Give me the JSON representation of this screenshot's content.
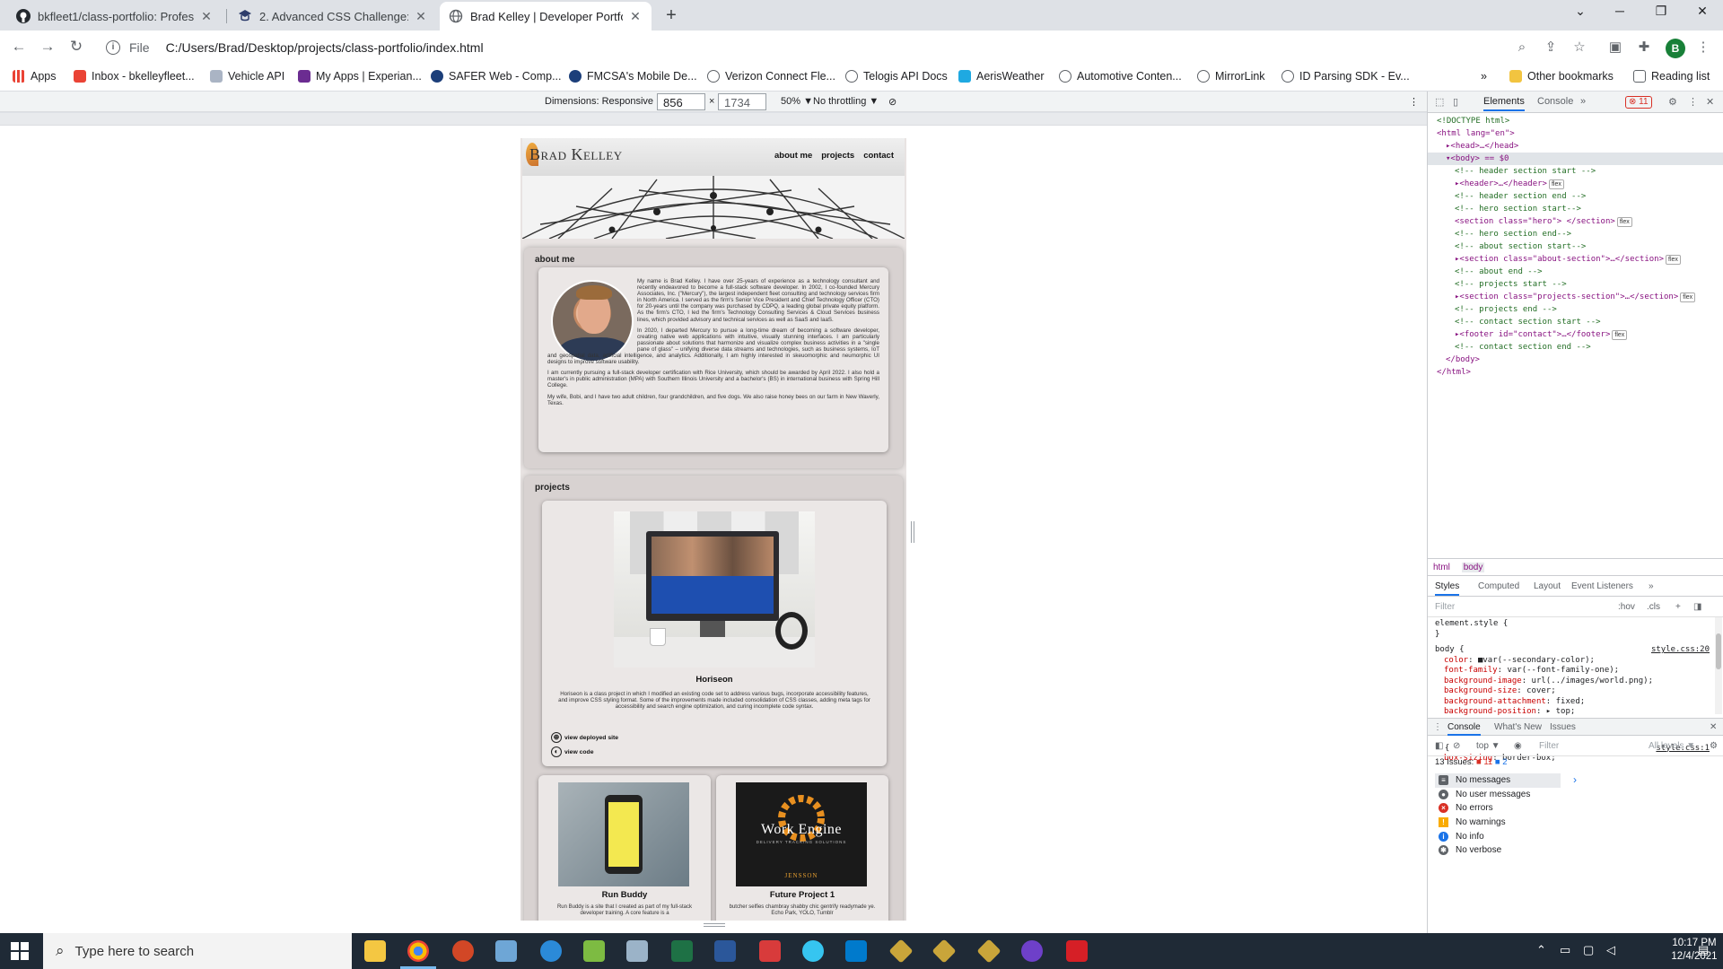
{
  "browser": {
    "tabs": [
      {
        "title": "bkfleet1/class-portfolio: Professi",
        "icon": "github-icon"
      },
      {
        "title": "2. Advanced CSS Challenge: Prof",
        "icon": "bootcamp-icon"
      },
      {
        "title": "Brad Kelley | Developer Portfolio",
        "icon": "globe-icon",
        "active": true
      }
    ],
    "address": {
      "scheme_label": "File",
      "url": "C:/Users/Brad/Desktop/projects/class-portfolio/index.html"
    },
    "profile_initial": "B",
    "bookmarks": [
      "Apps",
      "Inbox - bkelleyfleet...",
      "Vehicle API",
      "My Apps | Experian...",
      "SAFER Web - Comp...",
      "FMCSA's Mobile De...",
      "Verizon Connect Fle...",
      "Telogis API Docs",
      "AerisWeather",
      "Automotive Conten...",
      "MirrorLink",
      "ID Parsing SDK - Ev..."
    ],
    "other_bookmarks": "Other bookmarks",
    "reading_list": "Reading list",
    "overflow": "»"
  },
  "device_toolbar": {
    "dimensions_label": "Dimensions: Responsive ▼",
    "width": "856",
    "times": "×",
    "height": "1734",
    "zoom": "50% ▼",
    "throttling": "No throttling ▼"
  },
  "site": {
    "logo": {
      "first_big": "B",
      "first_rest": "RAD",
      "last_big": "K",
      "last_rest": "ELLEY"
    },
    "nav": [
      "about me",
      "projects",
      "contact"
    ],
    "about": {
      "title": "about me",
      "paragraphs": [
        "My name is Brad Kelley. I have over 25-years of experience as a technology consultant and recently endeavored to become a full-stack software developer. In 2002, I co-founded Mercury Associates, Inc. (\"Mercury\"), the largest independent fleet consulting and technology services firm in North America. I served as the firm's Senior Vice President and Chief Technology Officer (CTO) for 20-years until the company was purchased by CDPQ, a leading global private equity platform. As the firm's CTO, I led the firm's Technology Consulting Services & Cloud Services business lines, which provided advisory and technical services as well as SaaS and IaaS.",
        "In 2020, I departed Mercury to pursue a long-time dream of becoming a software developer, creating native web applications with intuitive, visually stunning interfaces. I am particularly passionate about solutions that harmonize and visualize complex business activities in a \"single pane of glass\" – unifying diverse data streams and technologies, such as business systems, IoT and geospatial data, artificial intelligence, and analytics. Additionally, I am highly interested in skeuomorphic and neumorphic UI designs to improve software usability.",
        "I am currently pursuing a full-stack developer certification with Rice University, which should be awarded by April 2022. I also hold a master's in public administration (MPA) with Southern Illinois University and a bachelor's (BS) in international business with Spring Hill College.",
        "My wife, Bobi, and I have two adult children, four grandchildren, and five dogs. We also raise honey bees on our farm in New Waverly, Texas."
      ]
    },
    "projects": {
      "title": "projects",
      "featured": {
        "name": "Horiseon",
        "description": "Horiseon is a class project in which I modified an existing code set to address various bugs, incorporate accessibility features, and improve CSS styling format. Some of the improvements made included consolidation of CSS classes, adding meta tags for accessibility and search engine optimization, and curing incomplete code syntax.",
        "link_site": "view deployed site",
        "link_code": "view code"
      },
      "small": [
        {
          "name": "Run Buddy",
          "description": "Run Buddy is a site that I created as part of my full-stack developer training. A core feature is a"
        },
        {
          "name": "Future Project 1",
          "description": "butcher selfies chambray shabby chic gentrify readymade ye. Echo Park, YOLO, Tumblr",
          "image_title": "Work Engine",
          "image_subtitle": "DELIVERY TRACKING SOLUTIONS",
          "image_brand": "JENSSON"
        }
      ]
    }
  },
  "devtools": {
    "tabs": [
      "Elements",
      "Console",
      "»"
    ],
    "error_count": "11",
    "dom": [
      {
        "t": "cm",
        "text": "<!DOCTYPE html>",
        "indent": 0
      },
      {
        "t": "tag",
        "text": "<html lang=\"en\">",
        "indent": 0
      },
      {
        "t": "tag",
        "text": "▸<head>…</head>",
        "indent": 1
      },
      {
        "t": "tag",
        "text": "▾<body> == $0",
        "indent": 1,
        "sel": true
      },
      {
        "t": "cm",
        "text": "<!-- header section start -->",
        "indent": 2
      },
      {
        "t": "tag",
        "text": "▸<header>…</header>",
        "indent": 2,
        "flex": true
      },
      {
        "t": "cm",
        "text": "<!-- header section end -->",
        "indent": 2
      },
      {
        "t": "cm",
        "text": "<!-- hero section start-->",
        "indent": 2
      },
      {
        "t": "tag",
        "text": "<section class=\"hero\"> </section>",
        "indent": 2,
        "flex": true
      },
      {
        "t": "cm",
        "text": "<!-- hero section  end-->",
        "indent": 2
      },
      {
        "t": "cm",
        "text": "<!-- about section start-->",
        "indent": 2
      },
      {
        "t": "tag",
        "text": "▸<section class=\"about-section\">…</section>",
        "indent": 2,
        "flex": true
      },
      {
        "t": "cm",
        "text": "<!-- about end -->",
        "indent": 2
      },
      {
        "t": "cm",
        "text": "<!-- projects start -->",
        "indent": 2
      },
      {
        "t": "tag",
        "text": "▸<section class=\"projects-section\">…</section>",
        "indent": 2,
        "flex": true
      },
      {
        "t": "cm",
        "text": "<!-- projects end -->",
        "indent": 2
      },
      {
        "t": "cm",
        "text": "<!-- contact section start -->",
        "indent": 2
      },
      {
        "t": "tag",
        "text": "▸<footer id=\"contact\">…</footer>",
        "indent": 2,
        "flex": true
      },
      {
        "t": "cm",
        "text": "<!-- contact section end -->",
        "indent": 2
      },
      {
        "t": "tag",
        "text": "</body>",
        "indent": 1
      },
      {
        "t": "tag",
        "text": "</html>",
        "indent": 0
      }
    ],
    "flex_label": "flex",
    "breadcrumbs": [
      "html",
      "body"
    ],
    "styles_tabs": [
      "Styles",
      "Computed",
      "Layout",
      "Event Listeners",
      "»"
    ],
    "filter_placeholder": "Filter",
    "hov": ":hov",
    "cls": ".cls",
    "css": {
      "element_style": "element.style {",
      "close": "}",
      "rule_selector": "body {",
      "rule_source": "style.css:20",
      "props": [
        {
          "name": "color",
          "value": "■var(--secondary-color);"
        },
        {
          "name": "font-family",
          "value": "var(--font-family-one);"
        },
        {
          "name": "background-image",
          "value": "url(../images/world.png);"
        },
        {
          "name": "background-size",
          "value": "cover;"
        },
        {
          "name": "background-attachment",
          "value": "fixed;"
        },
        {
          "name": "background-position",
          "value": "▸ top;"
        },
        {
          "name": "z-index",
          "value": "0;"
        }
      ],
      "rule2_selector": "* {",
      "rule2_source": "style.css:1",
      "rule2_prop": {
        "name": "box-sizing",
        "value": "border-box;"
      }
    },
    "drawer_tabs": [
      "Console",
      "What's New",
      "Issues"
    ],
    "console_context": "top ▼",
    "console_filter": "Filter",
    "levels": "All levels ▼",
    "issues": {
      "label": "13 Issues:",
      "red": "11",
      "blue": "2"
    },
    "messages": [
      "No messages",
      "No user messages",
      "No errors",
      "No warnings",
      "No info",
      "No verbose"
    ],
    "prompt": "›"
  },
  "taskbar": {
    "search_placeholder": "Type here to search",
    "time": "10:17 PM",
    "date": "12/4/2021"
  },
  "colors": {
    "accent": "#1a73e8",
    "error": "#d93025",
    "taskbar": "#1f2a36"
  }
}
